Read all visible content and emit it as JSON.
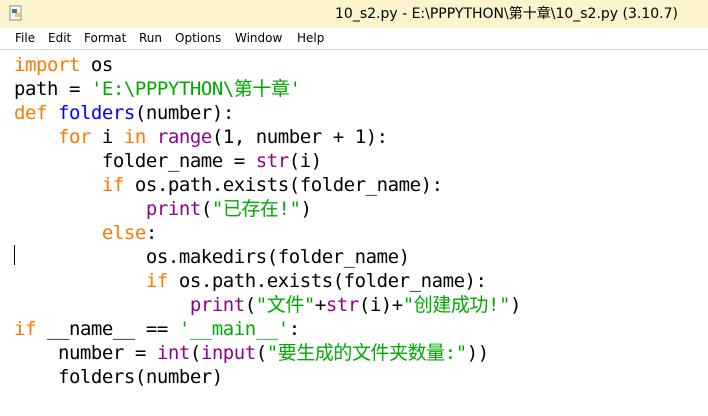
{
  "window": {
    "title": "10_s2.py - E:\\PPPYTHON\\第十章\\10_s2.py (3.10.7)",
    "icon": "python-file-icon"
  },
  "menu": [
    "File",
    "Edit",
    "Format",
    "Run",
    "Options",
    "Window",
    "Help"
  ],
  "code": {
    "l1": [
      "import",
      " os"
    ],
    "l2": [
      "path = ",
      "'E:\\PPPYTHON\\第十章'"
    ],
    "l3": [
      "def",
      " ",
      "folders",
      "(number):"
    ],
    "l4": [
      "    ",
      "for",
      " i ",
      "in",
      " ",
      "range",
      "(1, number + 1):"
    ],
    "l5": [
      "        folder_name = ",
      "str",
      "(i)"
    ],
    "l6": [
      "        ",
      "if",
      " os.path.exists(folder_name):"
    ],
    "l7": [
      "            ",
      "print",
      "(",
      "\"已存在!\"",
      ")"
    ],
    "l8": [
      "        ",
      "else",
      ":"
    ],
    "l9": [
      "            os.makedirs(folder_name)"
    ],
    "l10": [
      "            ",
      "if",
      " os.path.exists(folder_name):"
    ],
    "l11": [
      "                ",
      "print",
      "(",
      "\"文件\"",
      "+",
      "str",
      "(i)+",
      "\"创建成功!\"",
      ")"
    ],
    "l12": [
      "if",
      " __name__ == ",
      "'__main__'",
      ":"
    ],
    "l13": [
      "    number = ",
      "int",
      "(",
      "input",
      "(",
      "\"要生成的文件夹数量:\"",
      "))"
    ],
    "l14": [
      "    folders(number)"
    ]
  },
  "colors": {
    "keyword": "#ff7700",
    "string": "#00aa00",
    "builtin": "#900090",
    "definition": "#0000ff",
    "titlebar": "#fbf4cc"
  }
}
